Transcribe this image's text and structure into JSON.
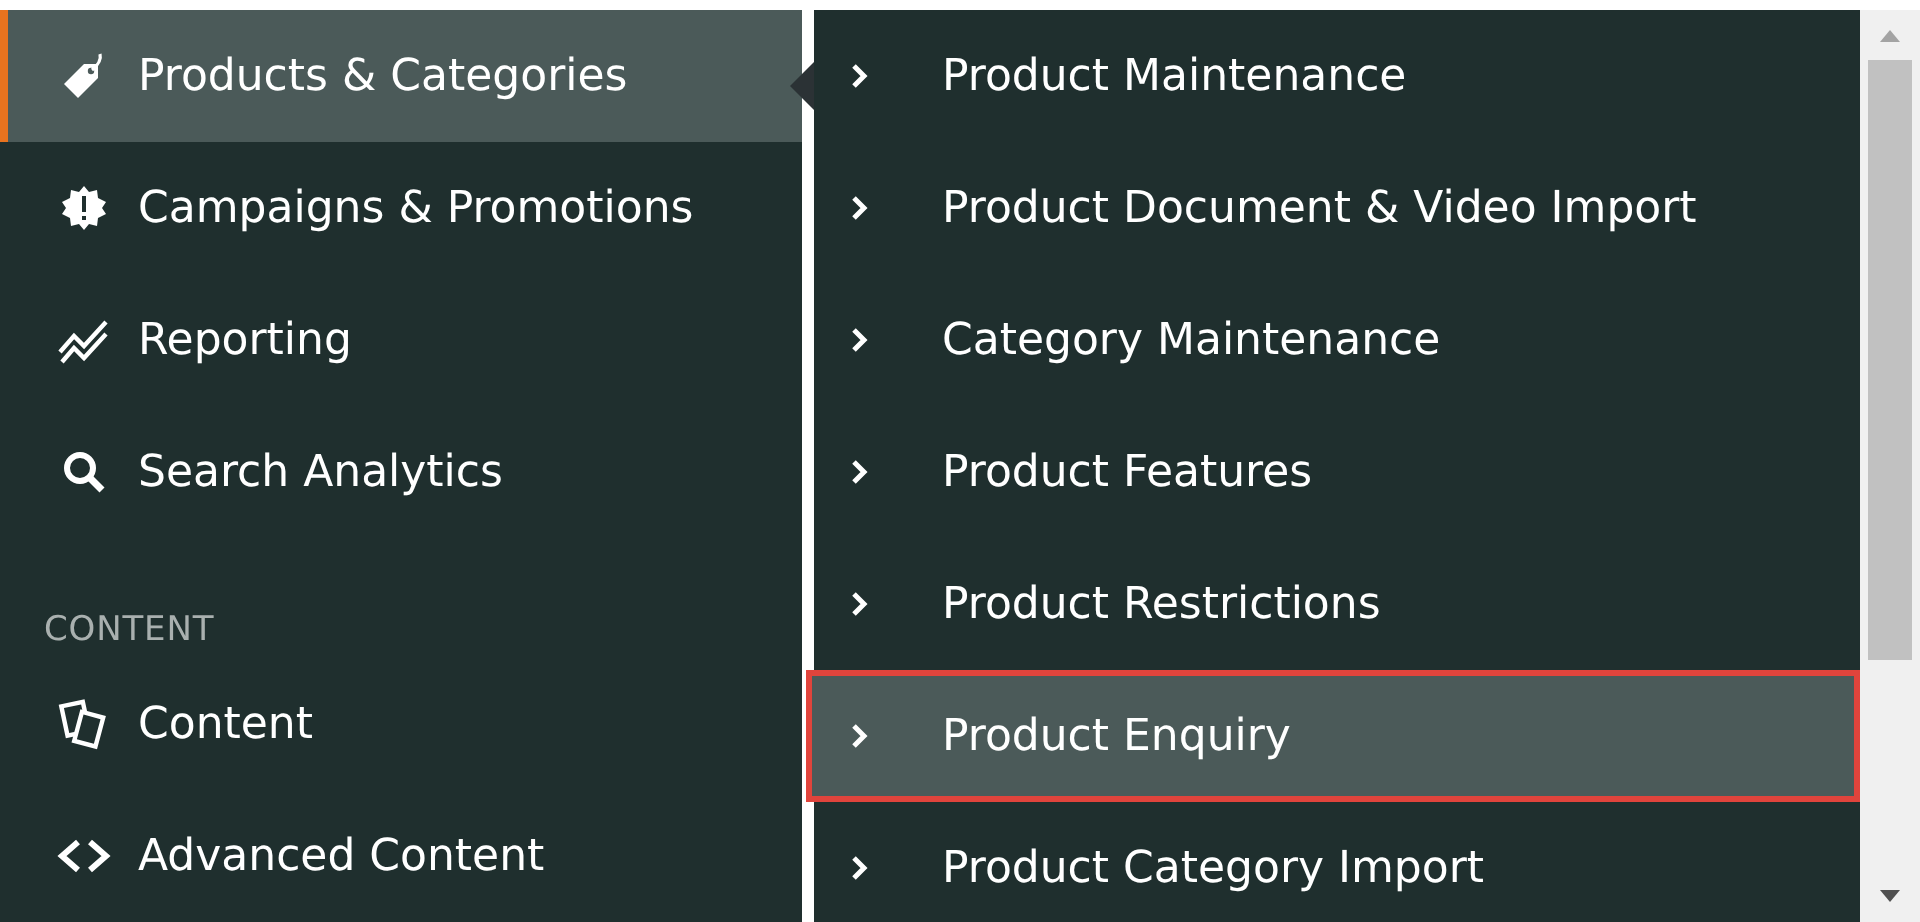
{
  "sidebar": {
    "items": [
      {
        "kind": "item",
        "label": "Products & Categories",
        "selected": true
      },
      {
        "kind": "item",
        "label": "Campaigns & Promotions",
        "selected": false
      },
      {
        "kind": "item",
        "label": "Reporting",
        "selected": false
      },
      {
        "kind": "item",
        "label": "Search Analytics",
        "selected": false
      },
      {
        "kind": "heading",
        "label": "CONTENT"
      },
      {
        "kind": "item",
        "label": "Content",
        "selected": false
      },
      {
        "kind": "item",
        "label": "Advanced Content",
        "selected": false
      }
    ]
  },
  "submenu": {
    "items": [
      {
        "label": "Product Maintenance",
        "selected": false
      },
      {
        "label": "Product Document & Video Import",
        "selected": false
      },
      {
        "label": "Category Maintenance",
        "selected": false
      },
      {
        "label": "Product Features",
        "selected": false
      },
      {
        "label": "Product Restrictions",
        "selected": false
      },
      {
        "label": "Product Enquiry",
        "selected": true
      },
      {
        "label": "Product Category Import",
        "selected": false
      }
    ]
  }
}
